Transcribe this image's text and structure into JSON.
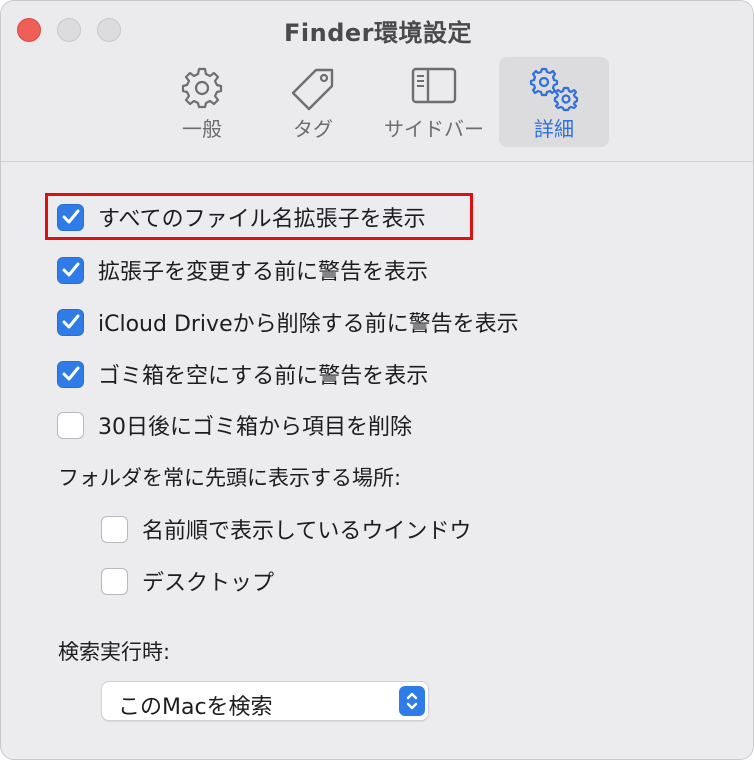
{
  "window": {
    "title": "Finder環境設定"
  },
  "toolbar": {
    "tabs": [
      {
        "label": "一般",
        "icon": "gear-icon",
        "selected": false
      },
      {
        "label": "タグ",
        "icon": "tag-icon",
        "selected": false
      },
      {
        "label": "サイドバー",
        "icon": "sidebar-icon",
        "selected": false
      },
      {
        "label": "詳細",
        "icon": "gears-icon",
        "selected": true
      }
    ]
  },
  "options": [
    {
      "label": "すべてのファイル名拡張子を表示",
      "checked": true
    },
    {
      "label": "拡張子を変更する前に警告を表示",
      "checked": true
    },
    {
      "label": "iCloud Driveから削除する前に警告を表示",
      "checked": true
    },
    {
      "label": "ゴミ箱を空にする前に警告を表示",
      "checked": true
    },
    {
      "label": "30日後にゴミ箱から項目を削除",
      "checked": false
    }
  ],
  "folders_first": {
    "label": "フォルダを常に先頭に表示する場所:",
    "options": [
      {
        "label": "名前順で表示しているウインドウ",
        "checked": false
      },
      {
        "label": "デスクトップ",
        "checked": false
      }
    ]
  },
  "search": {
    "label": "検索実行時:",
    "selected_value": "このMacを検索"
  },
  "colors": {
    "accent": "#2f7ce8",
    "highlight_box": "#dd1111",
    "close_button": "#ee5f57"
  }
}
